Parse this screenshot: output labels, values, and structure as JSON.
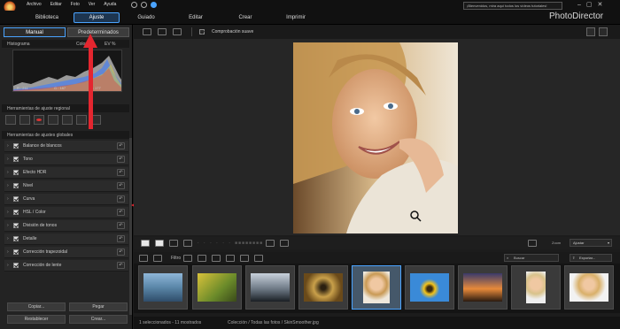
{
  "menu": [
    "Archivo",
    "Editar",
    "Foto",
    "Ver",
    "Ayuda"
  ],
  "search_top": {
    "placeholder": "¡Bienvenidos, mira aquí todos los vídeos tutoriales!"
  },
  "nav": {
    "tabs": [
      "Biblioteca",
      "Ajuste",
      "Guiado",
      "Editar",
      "Crear",
      "Imprimir"
    ],
    "active": "Ajuste",
    "app_name": "PhotoDirector"
  },
  "left_panel": {
    "tabs": [
      "Manual",
      "Predeterminados"
    ],
    "histogram": {
      "label": "Histograma",
      "color_label": "Color",
      "ev_label": "EV %",
      "readouts": [
        "R : 211",
        "G : 187",
        "B : 177"
      ]
    },
    "regional_tools": {
      "label": "Herramientas de ajuste regional"
    },
    "global_tools": {
      "label": "Herramientas de ajustes globales",
      "items": [
        "Balance de blancos",
        "Tono",
        "Efecto HDR",
        "Nivel",
        "Curva",
        "HSL / Color",
        "División de tonos",
        "Detalle",
        "Corrección trapezoidal",
        "Corrección de lente"
      ]
    },
    "buttons": {
      "copy": "Copiar...",
      "paste": "Pegar",
      "reset": "Restablecer",
      "create": "Crear..."
    }
  },
  "toolbar": {
    "smooth_check": "Comprobación suave"
  },
  "filmbar": {
    "zoom_label": "Zoom",
    "zoom_value": "Ajustar"
  },
  "filterbar": {
    "filters_label": "Filtro",
    "search_placeholder": "Buscar",
    "export_label": "Exportar..."
  },
  "status": {
    "left": "1 seleccionados - 11 mostrados",
    "path": "Colección / Todas las fotos / SkinSmoother.jpg"
  },
  "colors": {
    "accent": "#4aa3ff",
    "arrow": "#e4262f"
  }
}
